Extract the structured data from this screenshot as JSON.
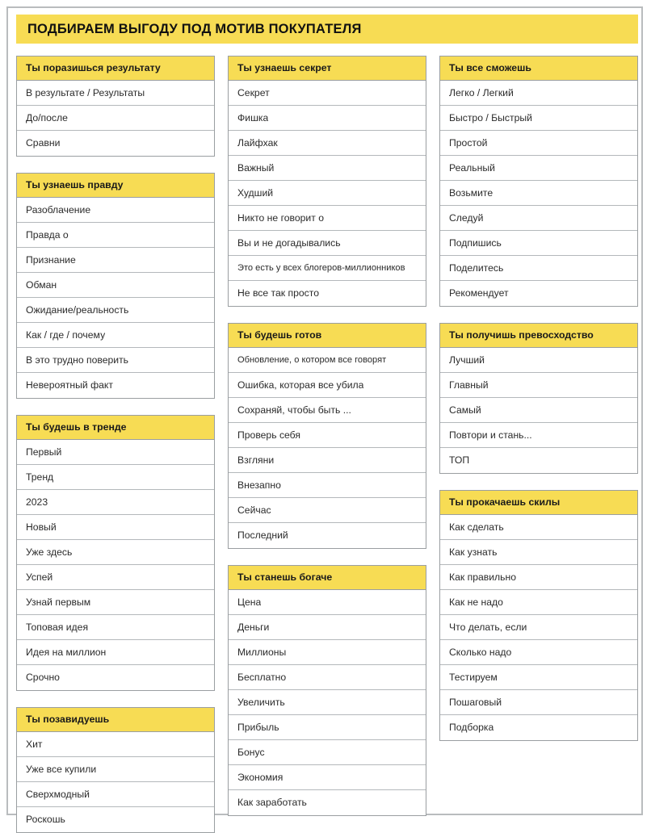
{
  "header": {
    "title": "ПОДБИРАЕМ ВЫГОДУ ПОД МОТИВ ПОКУПАТЕЛЯ"
  },
  "theme": {
    "accent": "#F7DC54",
    "border": "#9A9EA1",
    "row_border": "#B4B8BB",
    "text": "#2B2B2B",
    "page_border": "#B9BCBE",
    "background": "#FFFFFF"
  },
  "columns": [
    {
      "groups": [
        {
          "title": "Ты поразишься результату",
          "items": [
            "В результате / Результаты",
            "До/после",
            "Сравни"
          ]
        },
        {
          "title": "Ты узнаешь правду",
          "items": [
            "Разоблачение",
            "Правда о",
            "Признание",
            "Обман",
            "Ожидание/реальность",
            "Как / где / почему",
            "В это трудно поверить",
            "Невероятный факт"
          ]
        },
        {
          "title": "Ты будешь в тренде",
          "items": [
            "Первый",
            "Тренд",
            "2023",
            "Новый",
            "Уже здесь",
            "Успей",
            "Узнай первым",
            "Топовая идея",
            "Идея на миллион",
            "Срочно"
          ]
        },
        {
          "title": "Ты позавидуешь",
          "items": [
            "Хит",
            "Уже все купили",
            "Сверхмодный",
            "Роскошь"
          ]
        }
      ]
    },
    {
      "groups": [
        {
          "title": "Ты узнаешь секрет",
          "items": [
            "Секрет",
            "Фишка",
            "Лайфхак",
            "Важный",
            "Худший",
            "Никто не говорит о",
            "Вы и не догадывались",
            "Это есть у всех блогеров-миллионников",
            "Не все так просто"
          ]
        },
        {
          "title": "Ты будешь готов",
          "items": [
            "Обновление, о котором все говорят",
            "Ошибка, которая все убила",
            "Сохраняй, чтобы быть ...",
            "Проверь себя",
            "Взгляни",
            "Внезапно",
            "Сейчас",
            "Последний"
          ]
        },
        {
          "title": "Ты станешь богаче",
          "items": [
            "Цена",
            "Деньги",
            "Миллионы",
            "Бесплатно",
            "Увеличить",
            "Прибыль",
            "Бонус",
            "Экономия",
            "Как заработать"
          ]
        }
      ]
    },
    {
      "groups": [
        {
          "title": "Ты все сможешь",
          "items": [
            "Легко / Легкий",
            "Быстро / Быстрый",
            "Простой",
            "Реальный",
            "Возьмите",
            "Следуй",
            "Подпишись",
            "Поделитесь",
            "Рекомендует"
          ]
        },
        {
          "title": "Ты получишь превосходство",
          "items": [
            "Лучший",
            "Главный",
            "Самый",
            "Повтори и стань...",
            "ТОП"
          ]
        },
        {
          "title": "Ты прокачаешь скилы",
          "items": [
            "Как сделать",
            "Как узнать",
            "Как правильно",
            "Как не надо",
            "Что делать, если",
            "Сколько надо",
            "Тестируем",
            "Пошаговый",
            "Подборка"
          ]
        }
      ]
    }
  ]
}
